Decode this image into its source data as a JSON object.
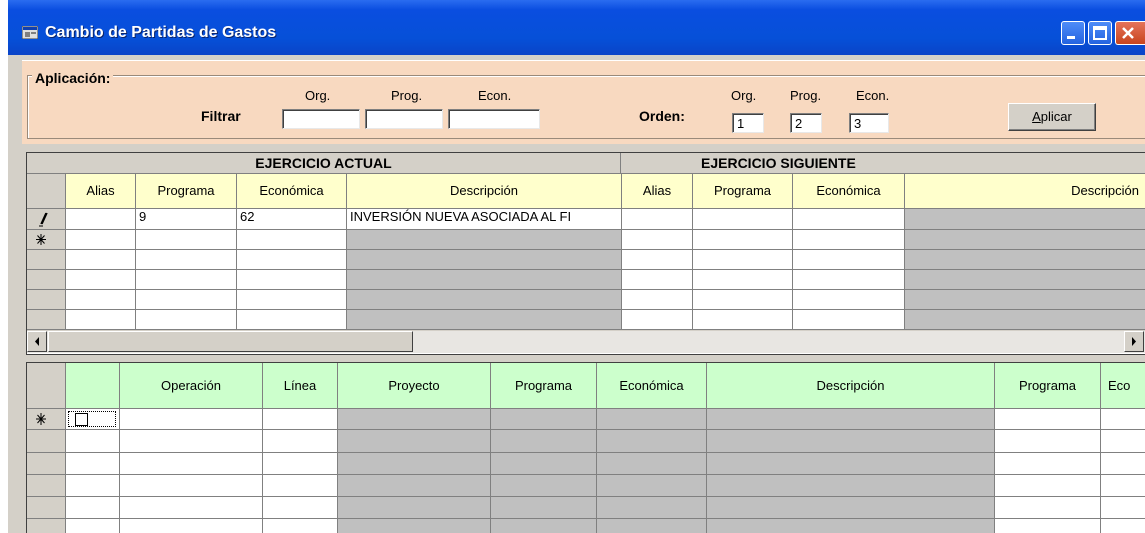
{
  "window": {
    "title": "Cambio de Partidas de Gastos",
    "colors": {
      "titlebar": "#0650d8",
      "appbar": "#f8d9c0",
      "header_actual": "#ffffcc",
      "header_siguiente": "#ccffcc"
    }
  },
  "aplicacion": {
    "group_label": "Aplicación:",
    "filtrar_label": "Filtrar",
    "filtrar_cols": [
      "Org.",
      "Prog.",
      "Econ."
    ],
    "filtrar_values": [
      "",
      "",
      ""
    ],
    "orden_label": "Orden:",
    "orden_cols": [
      "Org.",
      "Prog.",
      "Econ."
    ],
    "orden_values": [
      "1",
      "2",
      "3"
    ],
    "apply_button": {
      "accel": "A",
      "rest": "plicar"
    }
  },
  "grid_top": {
    "group_actual": "EJERCICIO ACTUAL",
    "group_siguiente": "EJERCICIO SIGUIENTE",
    "columns": [
      "Alias",
      "Programa",
      "Económica",
      "Descripción",
      "Alias",
      "Programa",
      "Económica",
      "Descripción"
    ],
    "rows": [
      {
        "marker": "edit-pencil-icon",
        "cells": [
          "",
          "9",
          "62",
          "INVERSIÓN NUEVA ASOCIADA AL FI",
          "",
          "",
          "",
          ""
        ]
      },
      {
        "marker": "new-row-icon",
        "cells": [
          "",
          "",
          "",
          "",
          "",
          "",
          "",
          ""
        ]
      },
      {
        "marker": "",
        "cells": [
          "",
          "",
          "",
          "",
          "",
          "",
          "",
          ""
        ]
      },
      {
        "marker": "",
        "cells": [
          "",
          "",
          "",
          "",
          "",
          "",
          "",
          ""
        ]
      },
      {
        "marker": "",
        "cells": [
          "",
          "",
          "",
          "",
          "",
          "",
          "",
          ""
        ]
      },
      {
        "marker": "",
        "cells": [
          "",
          "",
          "",
          "",
          "",
          "",
          "",
          ""
        ]
      }
    ]
  },
  "grid_bottom": {
    "columns": [
      "",
      "Operación",
      "Línea",
      "Proyecto",
      "Programa",
      "Económica",
      "Descripción",
      "Programa",
      "Eco"
    ],
    "rows": [
      {
        "marker": "new-row-icon",
        "checkbox": false
      },
      {
        "marker": "",
        "checkbox": null
      },
      {
        "marker": "",
        "checkbox": null
      },
      {
        "marker": "",
        "checkbox": null
      },
      {
        "marker": "",
        "checkbox": null
      },
      {
        "marker": "",
        "checkbox": null
      }
    ]
  }
}
